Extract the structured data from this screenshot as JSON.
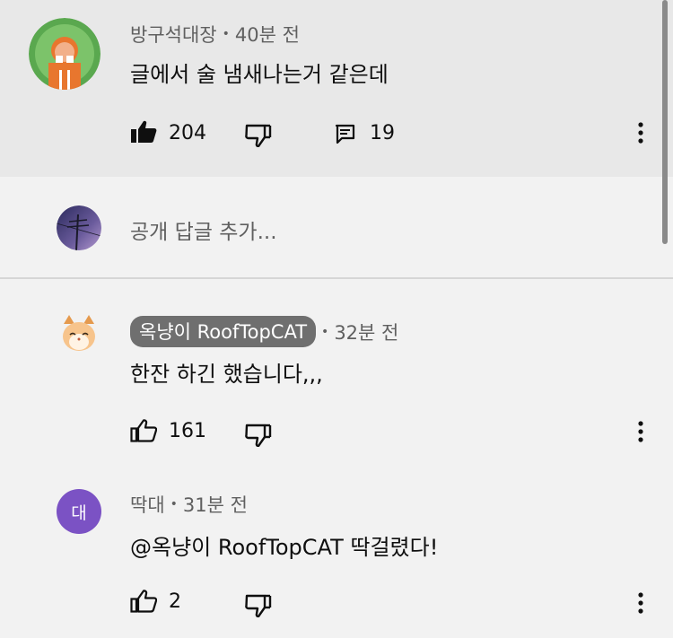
{
  "comment1": {
    "author": "방구석대장",
    "time": "40분 전",
    "text": "글에서 술 냄새나는거 같은데",
    "likes": "204",
    "replies": "19",
    "avatar_colors": {
      "bg": "#5aa84f",
      "accent": "#e8762e"
    }
  },
  "reply_input": {
    "placeholder": "공개 답글 추가..."
  },
  "comment2": {
    "author": "옥냥이 RoofTopCAT",
    "time": "32분 전",
    "text": "한잔 하긴 했습니다,,,",
    "likes": "161"
  },
  "comment3": {
    "author": "딱대",
    "time": "31분 전",
    "avatar_letter": "대",
    "text": "@옥냥이 RoofTopCAT 딱걸렸다!",
    "likes": "2"
  },
  "icons": {
    "like_filled": "thumbs-up-filled-icon",
    "like": "thumbs-up-icon",
    "dislike": "thumbs-down-icon",
    "reply": "comment-icon",
    "more": "more-vert-icon"
  },
  "colors": {
    "highlight_bg": "#e8e8e8",
    "page_bg": "#f2f2f2",
    "badge_bg": "#6f6f6f",
    "letter_avatar": "#7b52c4"
  }
}
